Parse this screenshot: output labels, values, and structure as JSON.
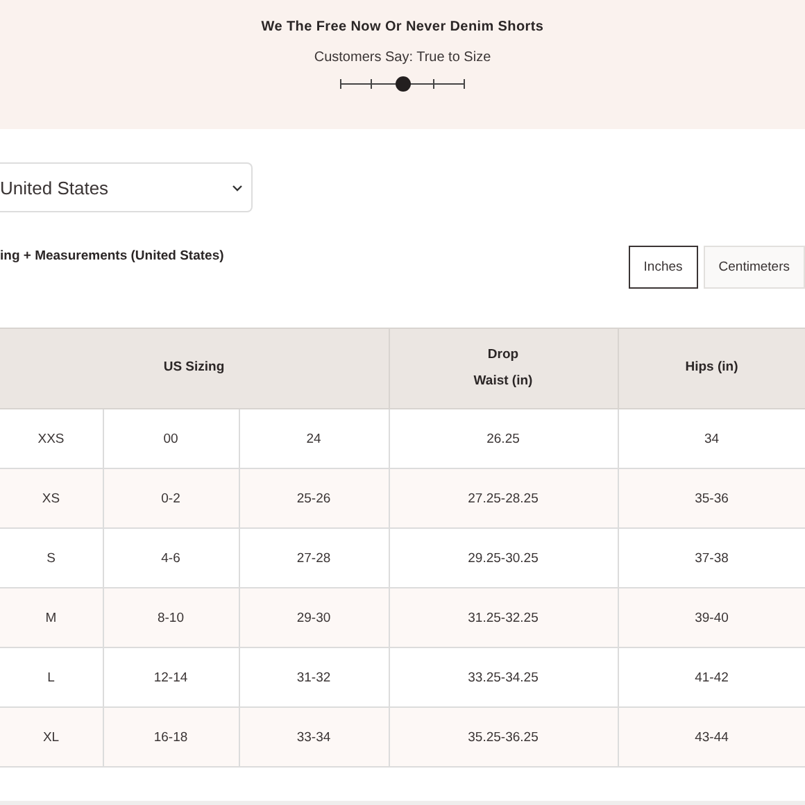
{
  "product": {
    "title": "We The Free Now Or Never Denim Shorts",
    "fit_label": "Customers Say: True to Size",
    "fit_scale": {
      "level": 0.5
    }
  },
  "region_select": {
    "value": "United States"
  },
  "table_heading": "ing + Measurements (United States)",
  "units": [
    {
      "label": "Inches",
      "selected": true
    },
    {
      "label": "Centimeters",
      "selected": false
    }
  ],
  "table": {
    "columns": [
      {
        "label": "US Sizing",
        "colspan": 3
      },
      {
        "label": "Drop\nWaist (in)"
      },
      {
        "label": "Hips (in)"
      }
    ],
    "rows": [
      [
        "XXS",
        "00",
        "24",
        "26.25",
        "34"
      ],
      [
        "XS",
        "0-2",
        "25-26",
        "27.25-28.25",
        "35-36"
      ],
      [
        "S",
        "4-6",
        "27-28",
        "29.25-30.25",
        "37-38"
      ],
      [
        "M",
        "8-10",
        "29-30",
        "31.25-32.25",
        "39-40"
      ],
      [
        "L",
        "12-14",
        "31-32",
        "33.25-34.25",
        "41-42"
      ],
      [
        "XL",
        "16-18",
        "33-34",
        "35.25-36.25",
        "43-44"
      ]
    ]
  }
}
